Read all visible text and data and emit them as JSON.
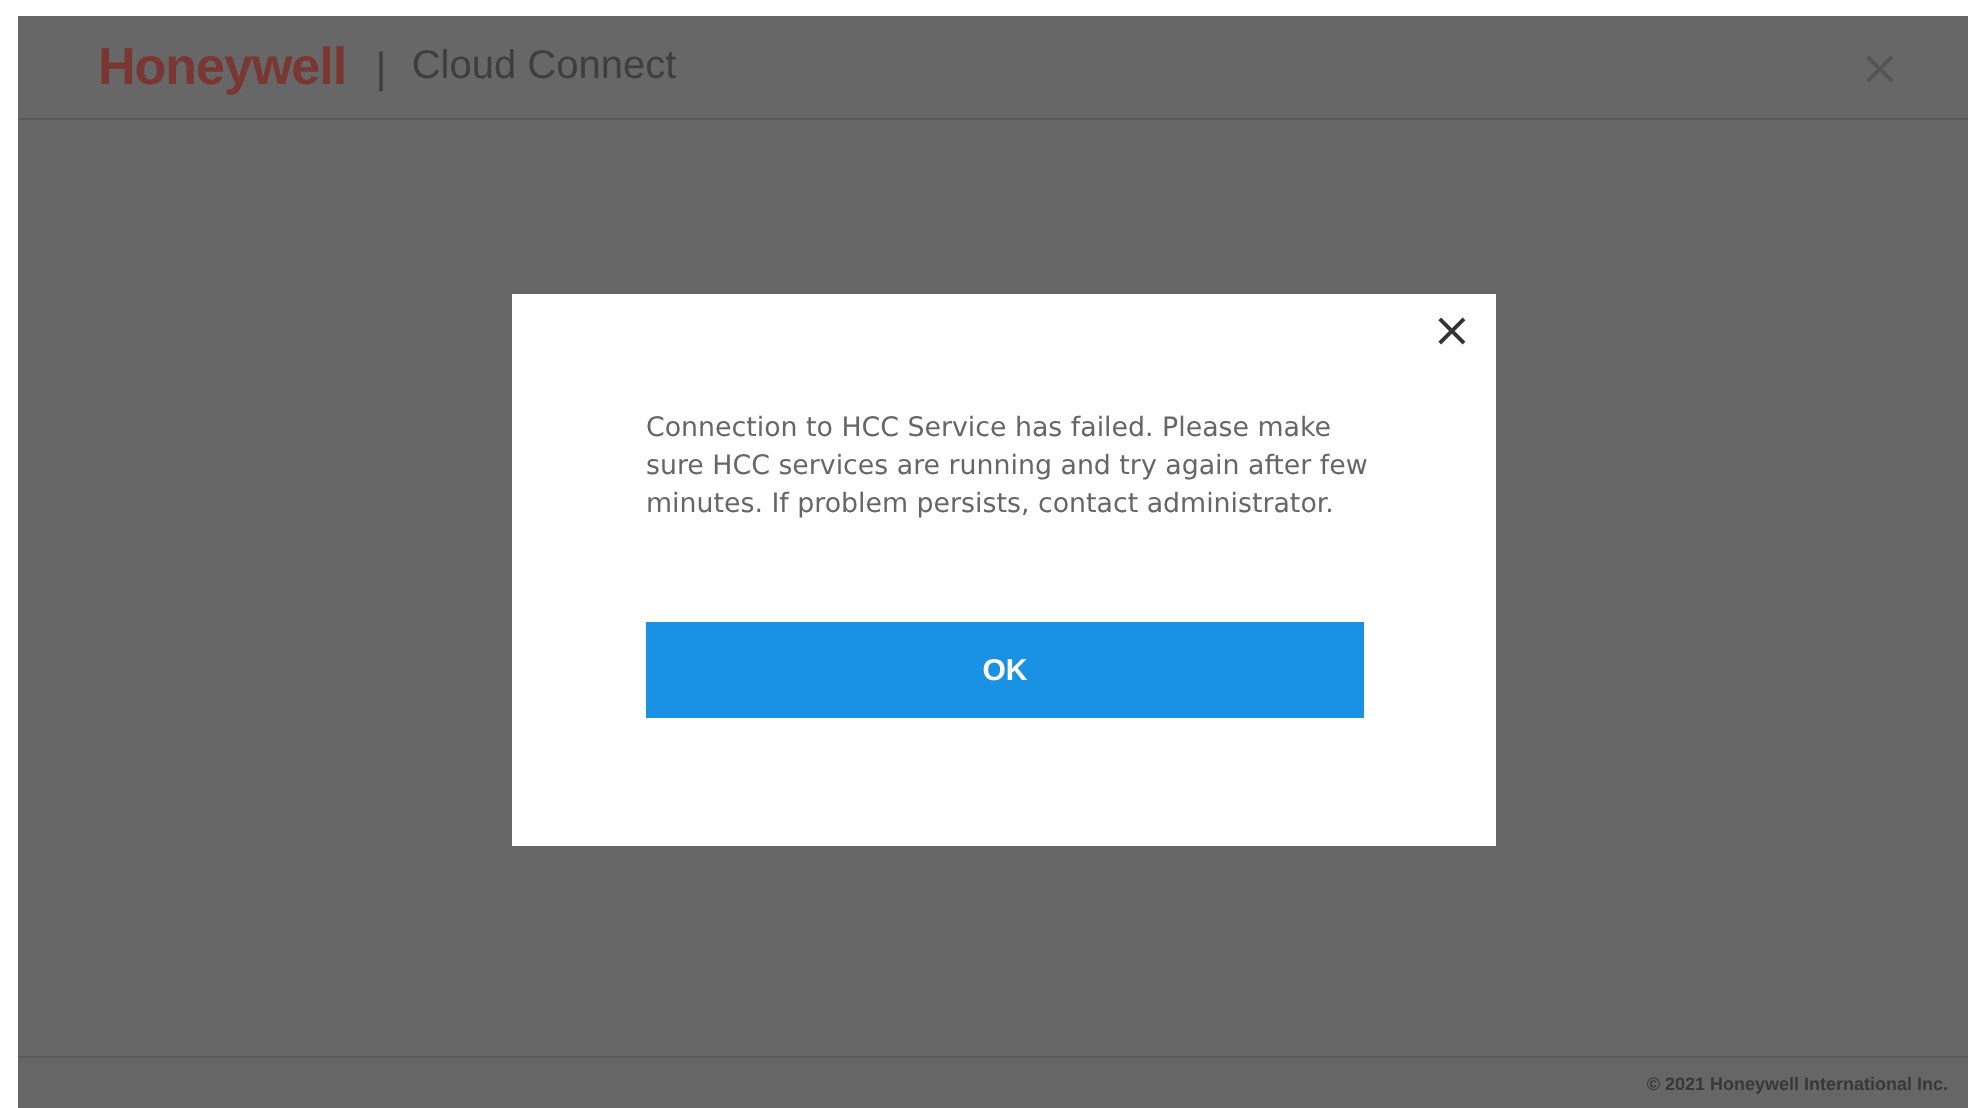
{
  "header": {
    "logo": "Honeywell",
    "separator": "|",
    "title": "Cloud Connect",
    "close": "×"
  },
  "dialog": {
    "close": "×",
    "message": "Connection to HCC Service has failed. Please make sure HCC services are running and try again after few minutes. If problem persists, contact administrator.",
    "button": "OK"
  },
  "footer": {
    "copyright": "© 2021 Honeywell International Inc."
  }
}
